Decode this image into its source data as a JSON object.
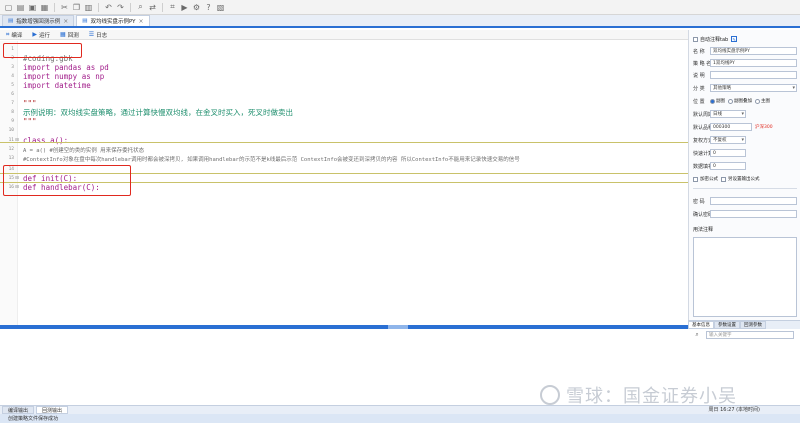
{
  "toolbar": {
    "icons": [
      "new-file-icon",
      "open-icon",
      "save-icon",
      "save-all-icon",
      "cut-icon",
      "copy-icon",
      "paste-icon",
      "undo-icon",
      "redo-icon",
      "find-icon",
      "replace-icon",
      "compile-icon",
      "run-icon",
      "settings-icon",
      "help-icon",
      "layout-icon"
    ]
  },
  "doc_tabs": [
    {
      "label": "指数增强回测示例",
      "active": false
    },
    {
      "label": "双均线实盘示例PY",
      "active": true
    }
  ],
  "editor_toolbar": [
    {
      "icon": "compile-icon",
      "label": "编译"
    },
    {
      "icon": "run-icon",
      "label": "运行"
    },
    {
      "icon": "back-test-icon",
      "label": "回测"
    },
    {
      "icon": "log-icon",
      "label": "日志"
    }
  ],
  "code_lines": [
    {
      "n": "1",
      "text": "",
      "cls": ""
    },
    {
      "n": "2",
      "text": "#coding:gbk",
      "cls": "c-comment"
    },
    {
      "n": "3",
      "text": "import pandas as pd",
      "cls": "c-kw"
    },
    {
      "n": "4",
      "text": "import numpy as np",
      "cls": "c-kw"
    },
    {
      "n": "5",
      "text": "import datetime",
      "cls": "c-kw"
    },
    {
      "n": "6",
      "text": "",
      "cls": ""
    },
    {
      "n": "7",
      "text": "\"\"\"",
      "cls": "c-str"
    },
    {
      "n": "8",
      "text": "示例说明：双均线实盘策略，通过计算快慢双均线，在金叉时买入，死叉时做卖出",
      "cls": "c-cn"
    },
    {
      "n": "9",
      "text": "\"\"\"",
      "cls": "c-str"
    },
    {
      "n": "10",
      "text": "",
      "cls": ""
    },
    {
      "n": "11",
      "text": "class a():",
      "cls": "c-kw"
    },
    {
      "n": "12",
      "text": "A = a() #创建空的类的实例 用来保存委托状态",
      "cls": "c-comment small"
    },
    {
      "n": "13",
      "text": "#ContextInfo对象在盘中每次handlebar调用时都会被深拷贝, 如果调用handlebar的示范不是k线最后示范 ContextInfo会被变还到深拷贝的内容 所以ContextInfo不能用来记录快速交易的信号",
      "cls": "c-comment small"
    },
    {
      "n": "14",
      "text": "",
      "cls": ""
    },
    {
      "n": "15",
      "text": "def init(C):",
      "cls": "c-def"
    },
    {
      "n": "16",
      "text": "def handlebar(C):",
      "cls": "c-def"
    }
  ],
  "properties": {
    "auto_tab_label": "自动注释tab",
    "name_label": "名  称",
    "name_value": "双均线实盘示例PY",
    "dev_name_label": "策 略 名",
    "dev_name_value": "1双均线PY",
    "note_label": "说  明",
    "note_value": "",
    "category_label": "分  类",
    "category_value": "其他策略",
    "position_label": "位  置",
    "position_options": [
      {
        "label": "副图",
        "on": true
      },
      {
        "label": "副图叠加",
        "on": false
      },
      {
        "label": "主图",
        "on": false
      }
    ],
    "period_label": "默认周期",
    "period_value": "日线",
    "stock_label": "默认品种",
    "stock_value": "000300",
    "stock_hint": "沪深300",
    "mode_label": "复权方式",
    "mode_value": "不复权",
    "days_label": "快速计算",
    "days_value": "0",
    "count_label": "数据填补",
    "count_value": "0",
    "encrypt_label": "加密公式",
    "output_label": "另设置输出公式",
    "password_label": "密  码",
    "confirm_label": "确认密码",
    "desc_label": "用法注释"
  },
  "panel_tabs": [
    {
      "label": "基本信息",
      "active": true
    },
    {
      "label": "参数设置",
      "active": false
    },
    {
      "label": "回测参数",
      "active": false
    }
  ],
  "panel_search_placeholder": "输入关键字",
  "bottom_tabs": [
    {
      "label": "编译输出",
      "active": false
    },
    {
      "label": "回测输出",
      "active": true
    }
  ],
  "status_text": "创建策略文件保存成功",
  "clock_text": "周日 16:27 (本地时间)",
  "watermark_text": "雪球：国金证券小吴"
}
